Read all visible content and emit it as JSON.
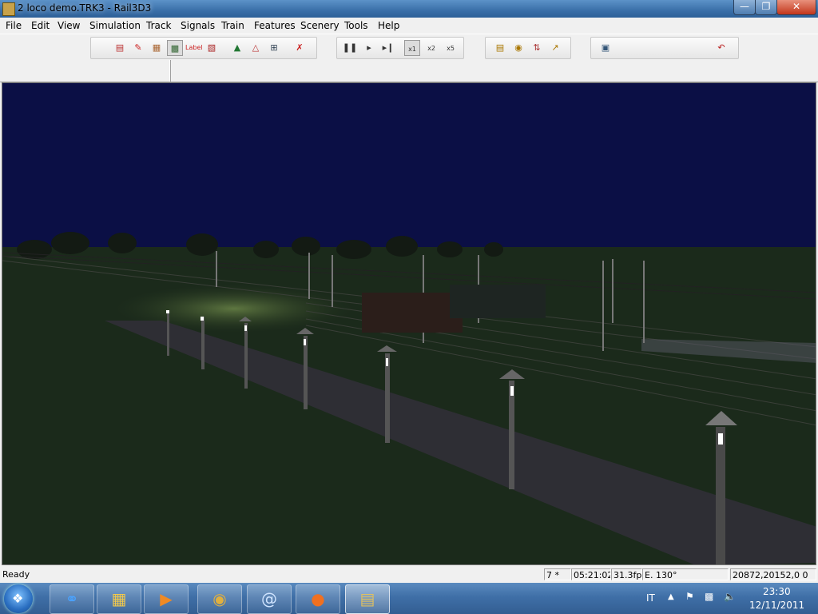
{
  "window": {
    "title": "2 loco demo.TRK3 - Rail3D3"
  },
  "menu": [
    "File",
    "Edit",
    "View",
    "Simulation",
    "Track",
    "Signals",
    "Train",
    "Features",
    "Scenery",
    "Tools",
    "Help"
  ],
  "toolbar": {
    "label_button": "Label",
    "speed_x1": "x1",
    "speed_x2": "x2",
    "speed_x5": "x5"
  },
  "status": {
    "ready": "Ready",
    "zoom": "7 *",
    "time": "05:21:02",
    "fps": "31.3fp",
    "heading": "E. 130°",
    "coords": "20872,20152,0 0"
  },
  "taskbar": {
    "lang": "IT",
    "clock_time": "23:30",
    "clock_date": "12/11/2011"
  },
  "colors": {
    "sky": "#0b0f45",
    "ground": "#1b2a1b",
    "path": "#2e2e34"
  }
}
